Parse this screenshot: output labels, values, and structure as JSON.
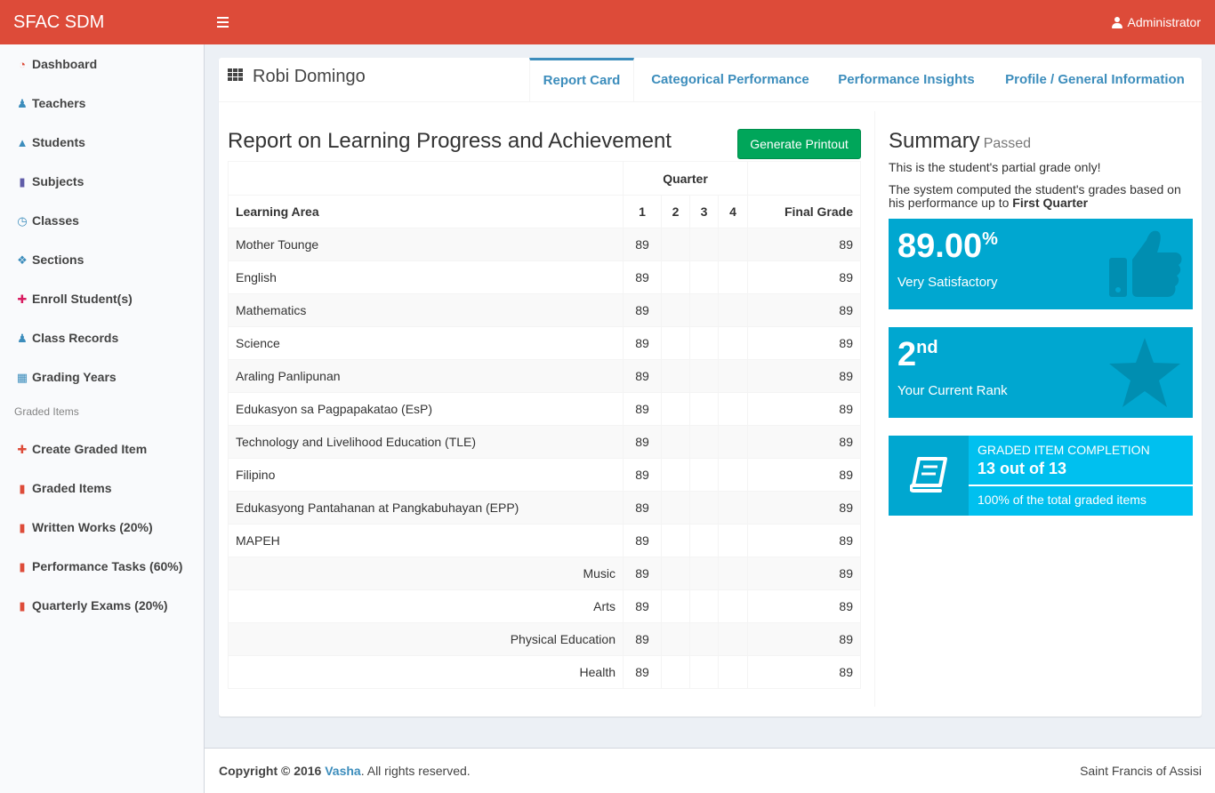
{
  "app": {
    "title": "SFAC SDM",
    "user": "Administrator"
  },
  "sidebar": {
    "items": [
      {
        "label": "Dashboard",
        "icon": "dashboard-icon",
        "color": "#dd4b39"
      },
      {
        "label": "Teachers",
        "icon": "users-icon",
        "color": "#3c8dbc"
      },
      {
        "label": "Students",
        "icon": "graduation-cap-icon",
        "color": "#3c8dbc"
      },
      {
        "label": "Subjects",
        "icon": "book-icon",
        "color": "#605ca8"
      },
      {
        "label": "Classes",
        "icon": "clock-icon",
        "color": "#3c8dbc"
      },
      {
        "label": "Sections",
        "icon": "cubes-icon",
        "color": "#3c8dbc"
      },
      {
        "label": "Enroll Student(s)",
        "icon": "plus-icon",
        "color": "#d81b60"
      },
      {
        "label": "Class Records",
        "icon": "users-icon",
        "color": "#3c8dbc"
      },
      {
        "label": "Grading Years",
        "icon": "calendar-icon",
        "color": "#3c8dbc"
      }
    ],
    "graded_header": "Graded Items",
    "graded_items": [
      {
        "label": "Create Graded Item",
        "icon": "plus-icon",
        "color": "#dd4b39"
      },
      {
        "label": "Graded Items",
        "icon": "book-icon",
        "color": "#dd4b39"
      },
      {
        "label": "Written Works (20%)",
        "icon": "book-icon",
        "color": "#dd4b39"
      },
      {
        "label": "Performance Tasks (60%)",
        "icon": "book-icon",
        "color": "#dd4b39"
      },
      {
        "label": "Quarterly Exams (20%)",
        "icon": "book-icon",
        "color": "#dd4b39"
      }
    ]
  },
  "student": {
    "name": "Robi Domingo"
  },
  "tabs": [
    "Report Card",
    "Categorical Performance",
    "Performance Insights",
    "Profile / General Information"
  ],
  "report": {
    "title": "Report on Learning Progress and Achievement",
    "print_button": "Generate Printout",
    "quarter_header": "Quarter",
    "col_area": "Learning Area",
    "col_q": [
      "1",
      "2",
      "3",
      "4"
    ],
    "col_final": "Final Grade",
    "rows": [
      {
        "area": "Mother Tounge",
        "q1": "89",
        "final": "89",
        "sub": false
      },
      {
        "area": "English",
        "q1": "89",
        "final": "89",
        "sub": false
      },
      {
        "area": "Mathematics",
        "q1": "89",
        "final": "89",
        "sub": false
      },
      {
        "area": "Science",
        "q1": "89",
        "final": "89",
        "sub": false
      },
      {
        "area": "Araling Panlipunan",
        "q1": "89",
        "final": "89",
        "sub": false
      },
      {
        "area": "Edukasyon sa Pagpapakatao (EsP)",
        "q1": "89",
        "final": "89",
        "sub": false
      },
      {
        "area": "Technology and Livelihood Education (TLE)",
        "q1": "89",
        "final": "89",
        "sub": false
      },
      {
        "area": "Filipino",
        "q1": "89",
        "final": "89",
        "sub": false
      },
      {
        "area": "Edukasyong Pantahanan at Pangkabuhayan (EPP)",
        "q1": "89",
        "final": "89",
        "sub": false
      },
      {
        "area": "MAPEH",
        "q1": "89",
        "final": "89",
        "sub": false
      },
      {
        "area": "Music",
        "q1": "89",
        "final": "89",
        "sub": true
      },
      {
        "area": "Arts",
        "q1": "89",
        "final": "89",
        "sub": true
      },
      {
        "area": "Physical Education",
        "q1": "89",
        "final": "89",
        "sub": true
      },
      {
        "area": "Health",
        "q1": "89",
        "final": "89",
        "sub": true
      }
    ]
  },
  "summary": {
    "title": "Summary",
    "status": "Passed",
    "note1": "This is the student's partial grade only!",
    "note2_prefix": "The system computed the student's grades based on his performance up to ",
    "note2_bold": "First Quarter",
    "grade_value": "89.00",
    "grade_unit": "%",
    "grade_label": "Very Satisfactory",
    "rank_value": "2",
    "rank_suffix": "nd",
    "rank_label": "Your Current Rank",
    "completion_title": "GRADED ITEM COMPLETION",
    "completion_count": "13 out of 13",
    "completion_desc": "100% of the total graded items",
    "completion_fraction": 1.0
  },
  "footer": {
    "copyright_prefix": "Copyright © 2016 ",
    "brand": "Vasha",
    "copyright_suffix": ". All rights reserved.",
    "right": "Saint Francis of Assisi"
  },
  "colors": {
    "header": "#dd4b39",
    "accent": "#3c8dbc",
    "success": "#00a65a",
    "aqua": "#00c0ef",
    "aqua_dark": "#00a7d0"
  }
}
